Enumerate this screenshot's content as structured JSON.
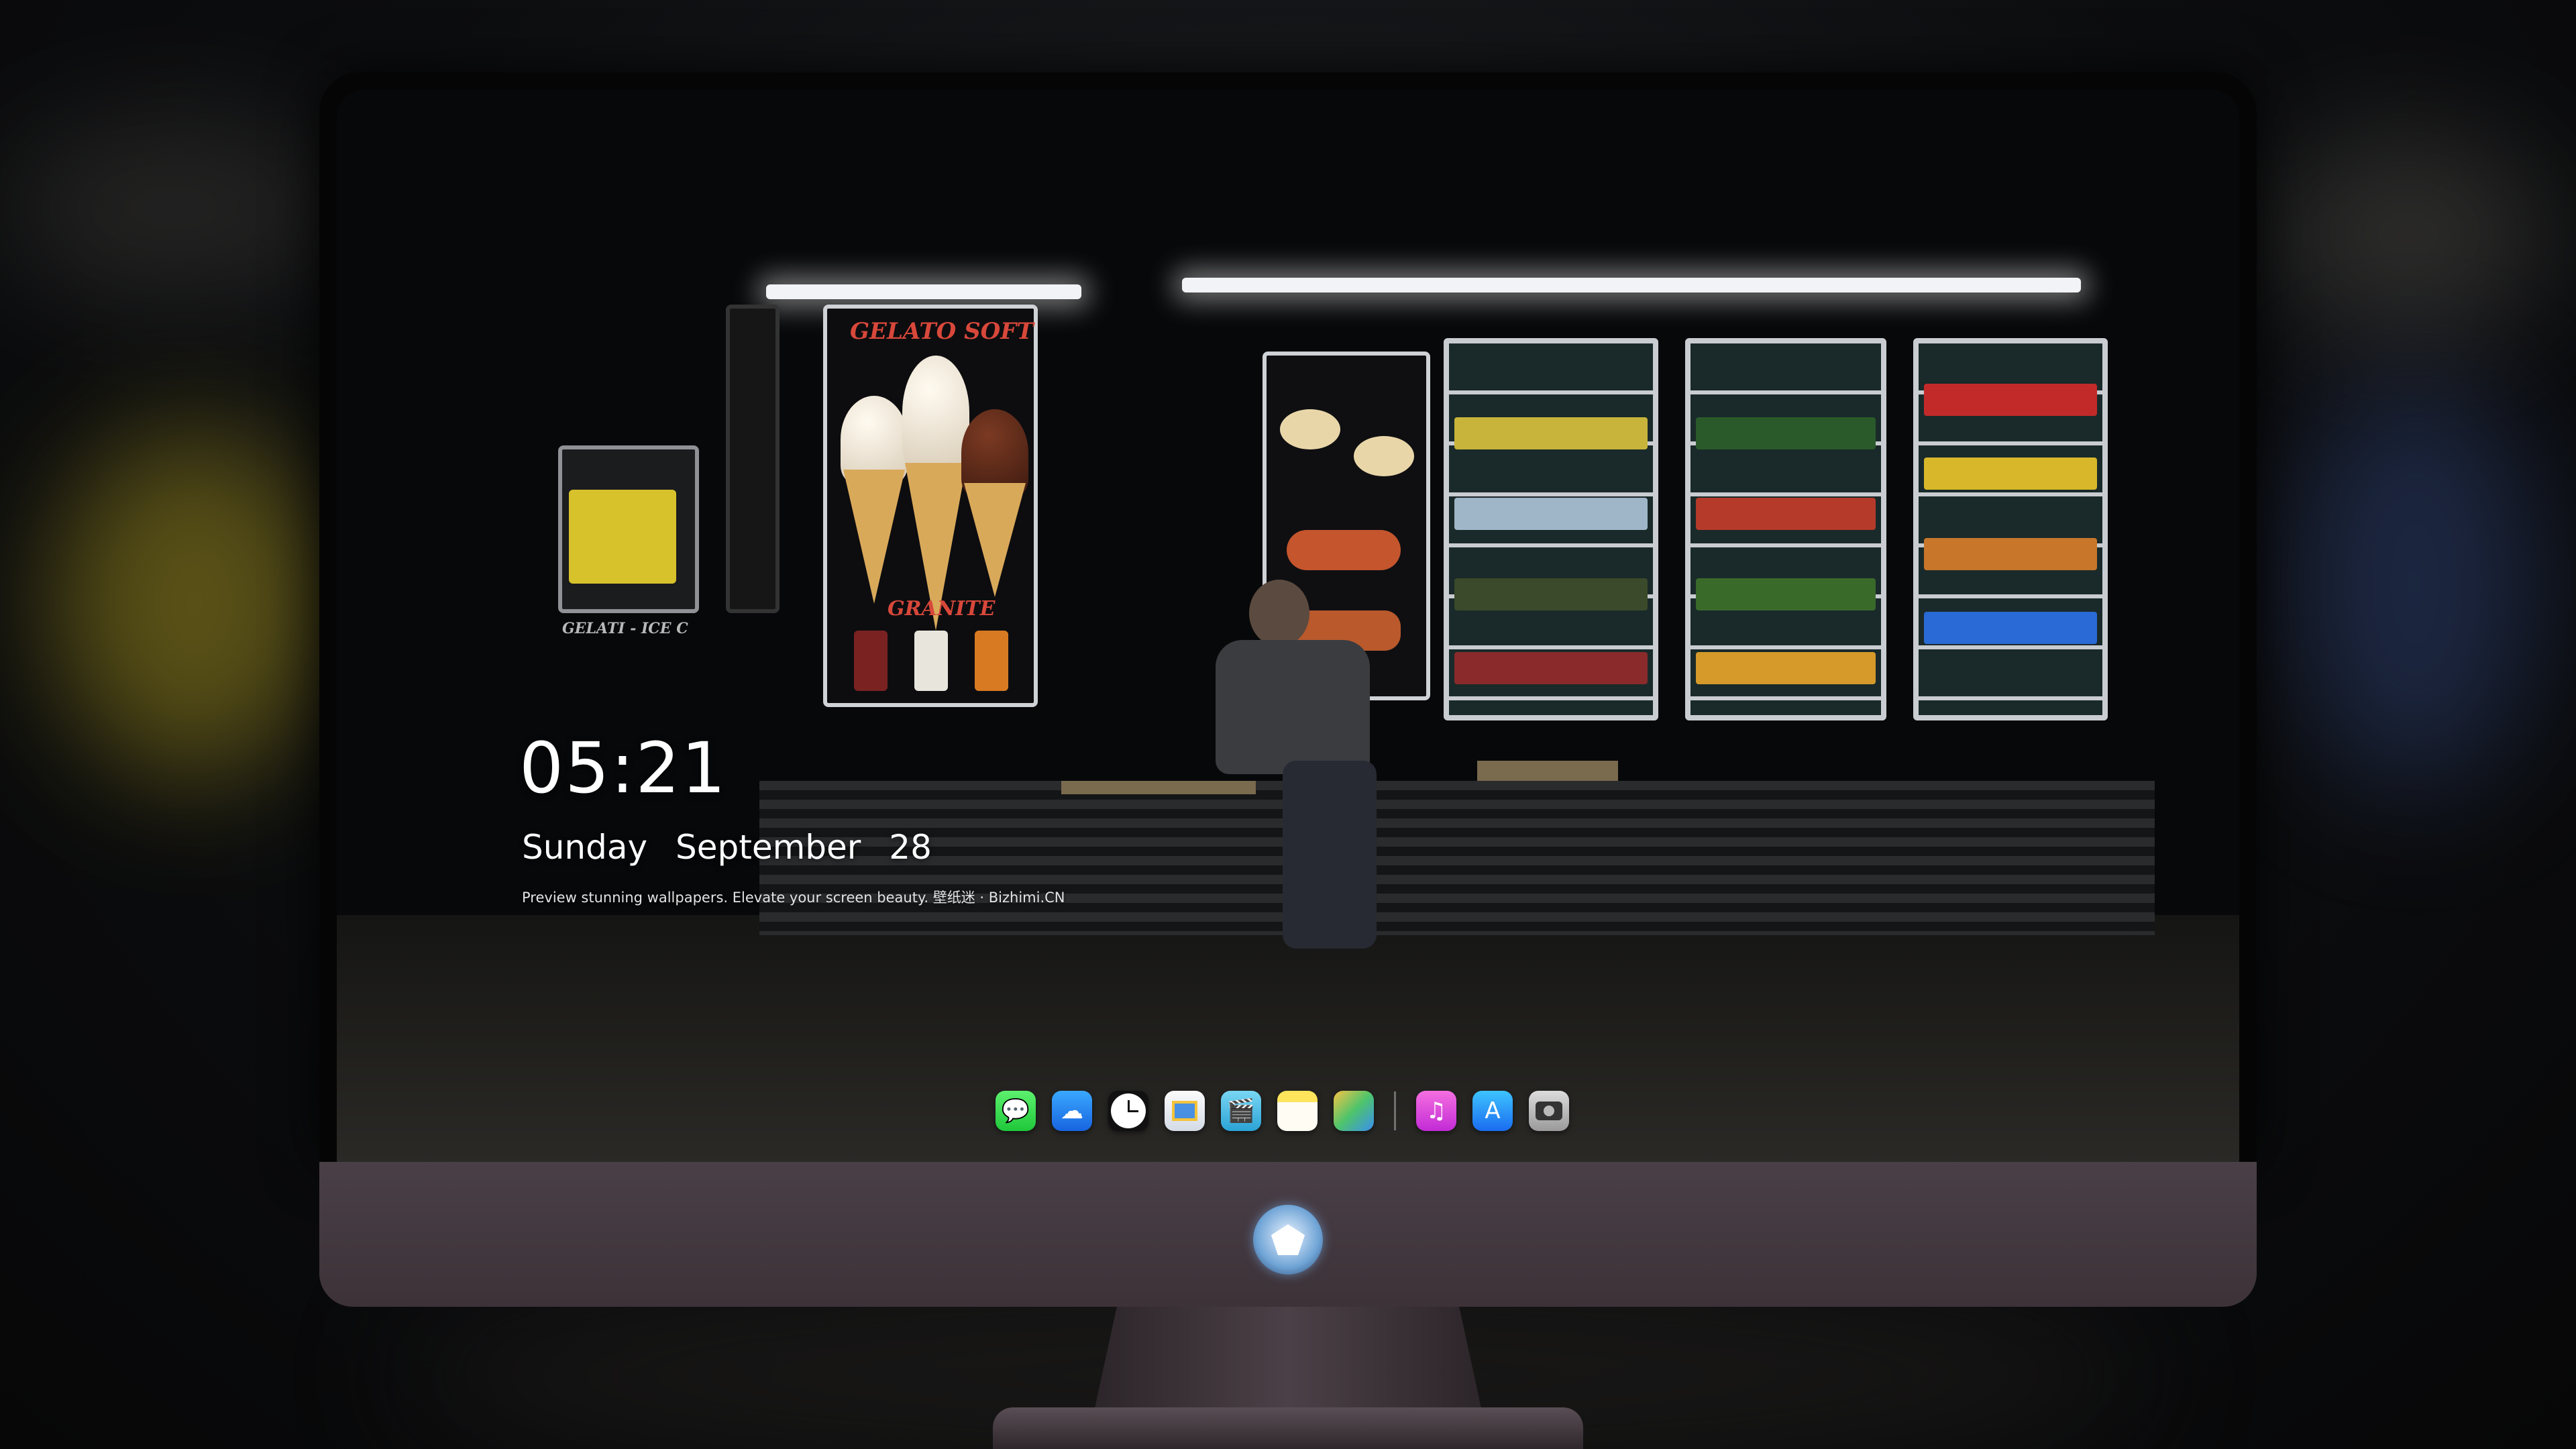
{
  "lock_screen": {
    "time": "05:21",
    "date": {
      "weekday": "Sunday",
      "month": "September",
      "day": "28"
    },
    "caption": "Preview stunning wallpapers. Elevate your screen beauty. 壁纸迷 · Bizhimi.CN"
  },
  "wallpaper": {
    "posters": {
      "gelato_soft": "GELATO SOFT",
      "granite": "GRANITE",
      "gelati_ice": "GELATI - ICE C"
    }
  },
  "dock": {
    "apps": [
      {
        "name": "Messages",
        "icon": "messages-icon"
      },
      {
        "name": "Weather",
        "icon": "weather-icon"
      },
      {
        "name": "Clock",
        "icon": "clock-icon"
      },
      {
        "name": "Preview",
        "icon": "preview-icon"
      },
      {
        "name": "Video",
        "icon": "video-icon"
      },
      {
        "name": "Notes",
        "icon": "notes-icon"
      },
      {
        "name": "Photos",
        "icon": "photos-icon"
      },
      {
        "name": "Music",
        "icon": "music-icon"
      },
      {
        "name": "App Store",
        "icon": "app-store-icon"
      },
      {
        "name": "Camera",
        "icon": "camera-icon"
      }
    ]
  },
  "colors": {
    "clock_text": "#ffffff",
    "monitor_chin": "#463b42",
    "accent_poster": "#d8483a"
  }
}
